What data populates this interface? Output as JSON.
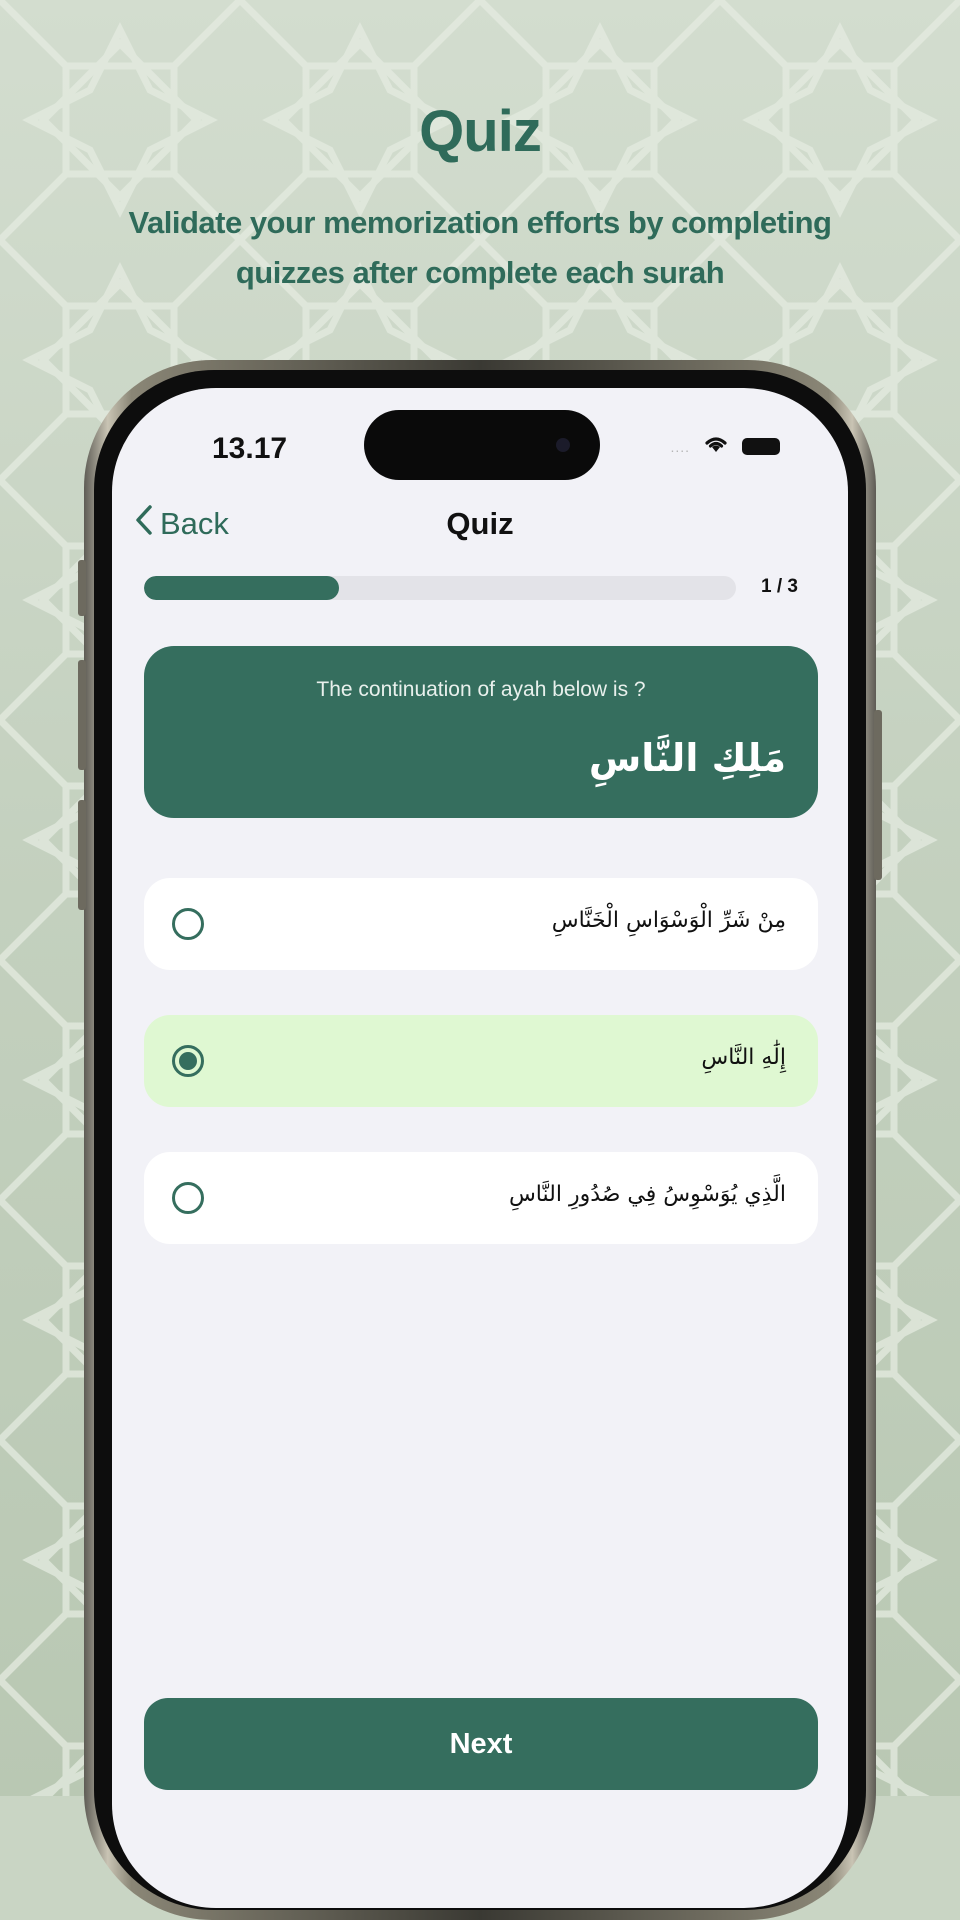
{
  "promo": {
    "title": "Quiz",
    "subtitle": "Validate your memorization efforts by completing quizzes after complete each surah"
  },
  "status_bar": {
    "time": "13.17",
    "signal": "....",
    "icons": [
      "wifi-icon",
      "battery-icon"
    ]
  },
  "nav": {
    "back_label": "Back",
    "title": "Quiz"
  },
  "progress": {
    "current": 1,
    "total": 3,
    "label": "1 / 3",
    "fraction": 0.33
  },
  "question": {
    "prompt": "The continuation of ayah below is ?",
    "ayah": "مَلِكِ النَّاسِ"
  },
  "options": [
    {
      "text": "مِنْ شَرِّ الْوَسْوَاسِ الْخَنَّاسِ",
      "selected": false
    },
    {
      "text": "إِلَٰهِ النَّاسِ",
      "selected": true
    },
    {
      "text": "الَّذِي يُوَسْوِسُ فِي صُدُورِ النَّاسِ",
      "selected": false
    }
  ],
  "actions": {
    "next_label": "Next"
  },
  "colors": {
    "primary": "#356e5e",
    "selected_bg": "#dff8d2",
    "screen_bg": "#f2f2f7",
    "background": "#c9d5c4"
  }
}
